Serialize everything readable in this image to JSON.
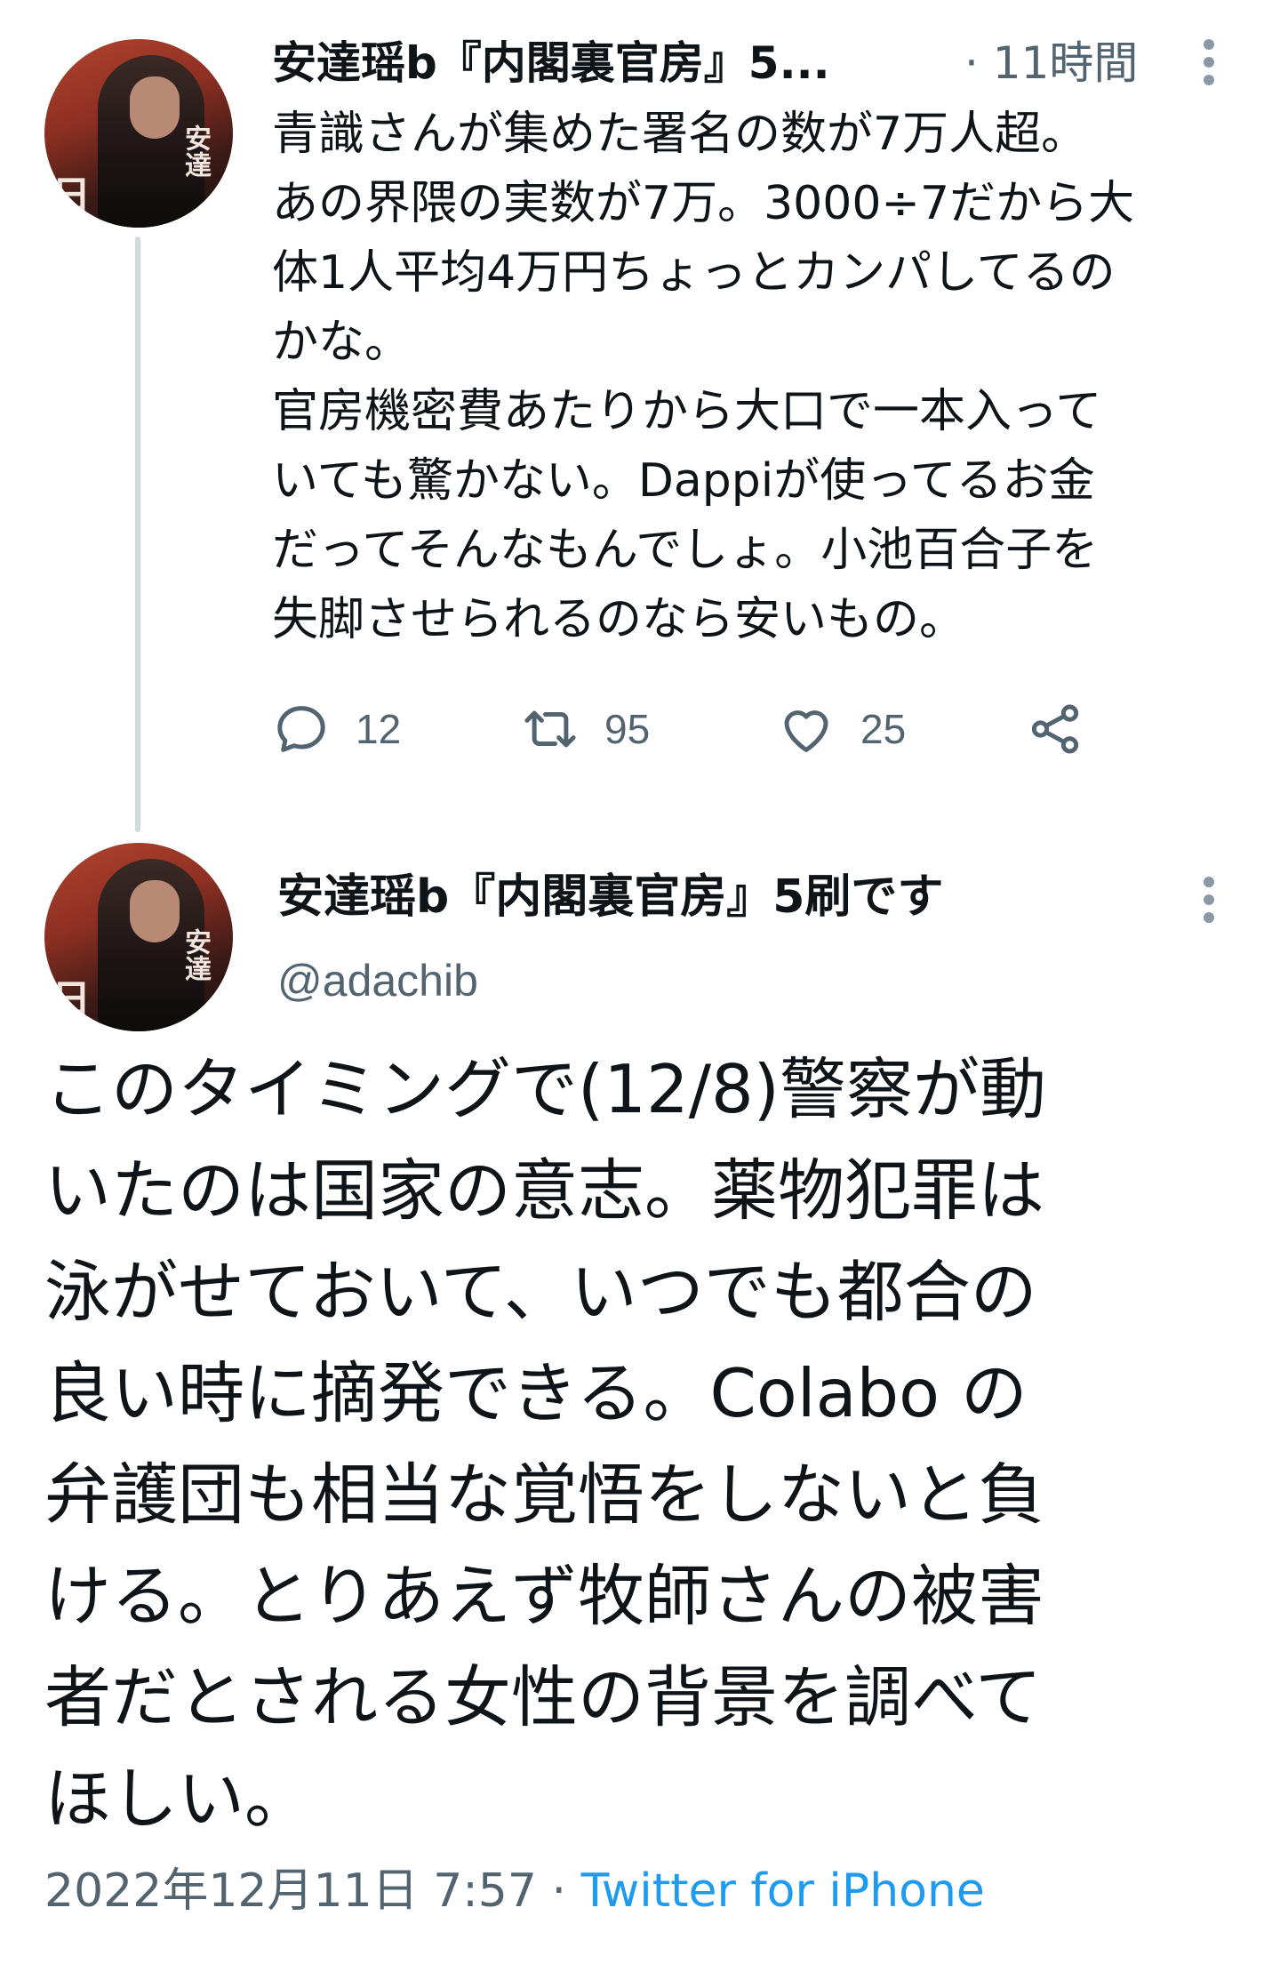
{
  "tweet1": {
    "author_name": "安達瑶b『内閣裏官房』5...",
    "time": "· 11時間",
    "text_lines": [
      "青識さんが集めた署名の数が7万人超。",
      "あの界隈の実数が7万。3000÷7だから大",
      "体1人平均4万円ちょっとカンパしてるの",
      "かな。",
      "官房機密費あたりから大口で一本入って",
      "いても驚かない。Dappiが使ってるお金",
      "だってそんなもんでしょ。小池百合子を",
      "失脚させられるのなら安いもの。"
    ],
    "replies": "12",
    "retweets": "95",
    "likes": "25"
  },
  "tweet2": {
    "author_name": "安達瑶b『内閣裏官房』5刷です",
    "handle": "@adachib",
    "text_lines": [
      "このタイミングで(12/8)警察が動",
      "いたのは国家の意志。薬物犯罪は",
      "泳がせておいて、いつでも都合の",
      "良い時に摘発できる。Colabo の",
      "弁護団も相当な覚悟をしないと負",
      "ける。とりあえず牧師さんの被害",
      "者だとされる女性の背景を調べて",
      "ほしい。"
    ],
    "timestamp": "2022年12月11日 7:57 · ",
    "source": "Twitter for iPhone"
  },
  "avatar": {
    "overlay_text": "安達",
    "overlay_text_left": "日"
  },
  "colors": {
    "text": "#0f1419",
    "secondary": "#536471",
    "link": "#1d9bf0",
    "thread_line": "#cfd9de"
  }
}
